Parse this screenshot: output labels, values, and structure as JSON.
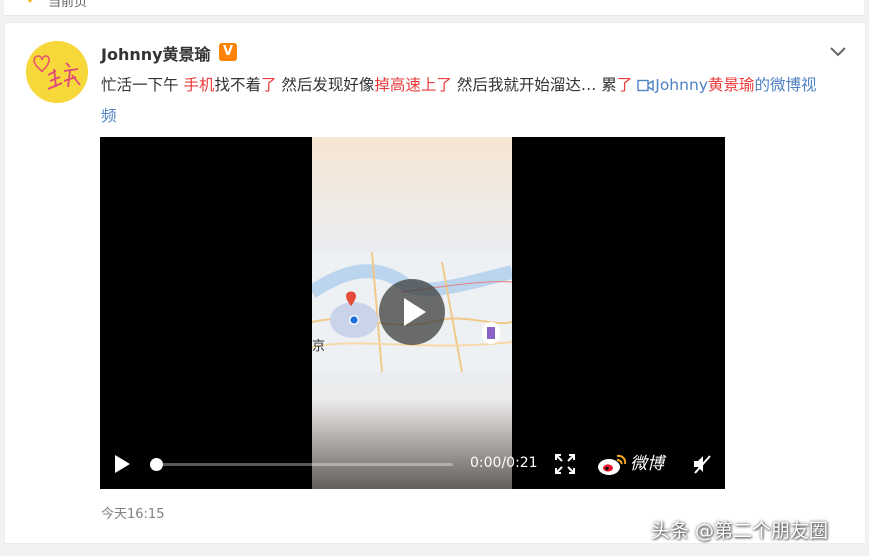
{
  "top_strip": {
    "partial_text": "当前页"
  },
  "post": {
    "username": "Johnny黄景瑜",
    "verified_badge": "V",
    "text_segments": [
      {
        "text": "忙活一下午 ",
        "style": "normal"
      },
      {
        "text": "手机",
        "style": "red"
      },
      {
        "text": "找不着",
        "style": "normal"
      },
      {
        "text": "了",
        "style": "red"
      },
      {
        "text": " 然后发现好像",
        "style": "normal"
      },
      {
        "text": "掉高速上了",
        "style": "red"
      },
      {
        "text": " 然后我就开始溜达… 累",
        "style": "normal"
      },
      {
        "text": "了",
        "style": "red"
      },
      {
        "text": " ",
        "style": "normal"
      }
    ],
    "video_link": {
      "icon": "video-icon",
      "parts": [
        {
          "text": "Johnny",
          "style": "link"
        },
        {
          "text": "黄景瑜",
          "style": "red"
        },
        {
          "text": "的微博视频",
          "style": "link"
        }
      ]
    },
    "timestamp": "今天16:15"
  },
  "player": {
    "time_display": "0:00/0:21",
    "progress": 0,
    "brand_text": "微博",
    "icons": {
      "big_play": "play-icon",
      "play": "play-icon",
      "fullscreen": "fullscreen-icon",
      "brand": "weibo-logo-icon",
      "mute": "mute-icon"
    }
  },
  "watermark": "头条 @第二个朋友圈",
  "colors": {
    "accent_red": "#eb3b3b",
    "link_blue": "#4e82c4",
    "badge_orange": "#ff8200"
  }
}
